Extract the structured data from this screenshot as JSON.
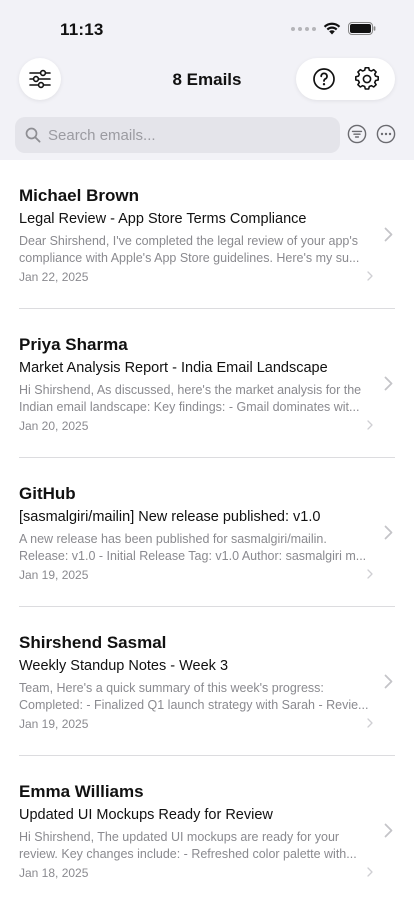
{
  "status": {
    "time": "11:13"
  },
  "header": {
    "title": "8 Emails"
  },
  "search": {
    "placeholder": "Search emails..."
  },
  "emails": [
    {
      "sender": "Michael Brown",
      "subject": "Legal Review - App Store Terms Compliance",
      "preview_line1": "Dear Shirshend,  I've completed the legal review of your app's",
      "preview_line2": "compliance with Apple's App Store guidelines. Here's my su...",
      "date": "Jan 22, 2025"
    },
    {
      "sender": "Priya Sharma",
      "subject": "Market Analysis Report - India Email Landscape",
      "preview_line1": "Hi Shirshend,  As discussed, here's the market analysis for the",
      "preview_line2": "Indian email landscape:  Key findings: - Gmail dominates wit...",
      "date": "Jan 20, 2025"
    },
    {
      "sender": "GitHub",
      "subject": "[sasmalgiri/mailin] New release published: v1.0",
      "preview_line1": "A new release has been published for sasmalgiri/mailin.",
      "preview_line2": "Release: v1.0 - Initial Release Tag: v1.0 Author: sasmalgiri  m...",
      "date": "Jan 19, 2025"
    },
    {
      "sender": "Shirshend Sasmal",
      "subject": "Weekly Standup Notes - Week 3",
      "preview_line1": "Team,  Here's a quick summary of this week's progress:",
      "preview_line2": "Completed: - Finalized Q1 launch strategy with Sarah - Revie...",
      "date": "Jan 19, 2025"
    },
    {
      "sender": "Emma Williams",
      "subject": "Updated UI Mockups Ready for Review",
      "preview_line1": "Hi Shirshend,  The updated UI mockups are ready for your",
      "preview_line2": "review. Key changes include:  - Refreshed color palette with...",
      "date": "Jan 18, 2025"
    }
  ]
}
